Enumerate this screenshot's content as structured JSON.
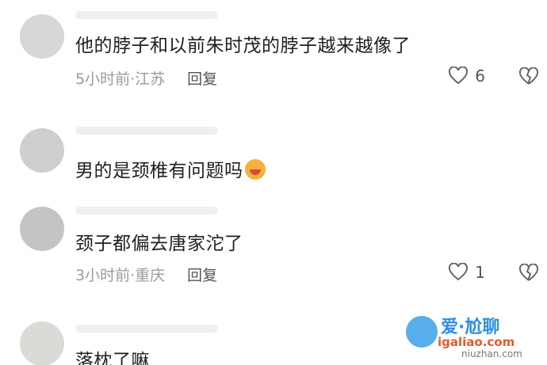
{
  "comments": [
    {
      "text": "他的脖子和以前朱时茂的脖子越来越像了",
      "time": "5小时前",
      "location": "江苏",
      "reply_label": "回复",
      "likes": "6"
    },
    {
      "text": "男的是颈椎有问题吗"
    },
    {
      "text": "颈子都偏去唐家沱了",
      "time": "3小时前",
      "location": "重庆",
      "reply_label": "回复",
      "likes": "1"
    },
    {
      "text": "落枕了嘛"
    }
  ],
  "separator": "·",
  "watermark": {
    "brand": "爱·尬聊",
    "site": "igaliao.com",
    "site2": "niuzhan.com"
  },
  "colors": {
    "text": "#1f1f1f",
    "meta": "#9a9a9a",
    "reply": "#555555"
  }
}
